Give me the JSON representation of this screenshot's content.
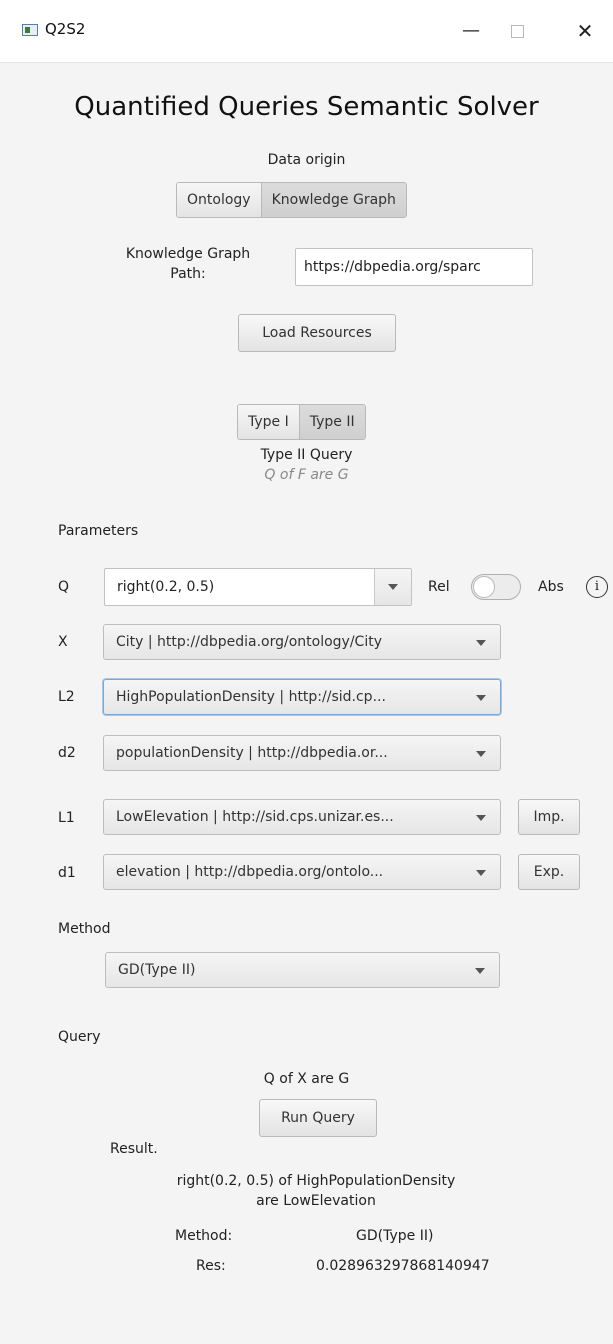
{
  "window": {
    "title": "Q2S2",
    "min_glyph": "—",
    "close_glyph": "✕"
  },
  "app_title": "Quantified Queries Semantic Solver",
  "data_origin": {
    "label": "Data origin",
    "options": [
      "Ontology",
      "Knowledge Graph"
    ],
    "selected": "Knowledge Graph"
  },
  "kg_path": {
    "label_line1": "Knowledge Graph",
    "label_line2": "Path:",
    "value": "https://dbpedia.org/sparc"
  },
  "load_button": "Load Resources",
  "query_type": {
    "options": [
      "Type I",
      "Type II"
    ],
    "selected": "Type II",
    "title": "Type II Query",
    "pattern": "Q of F are G"
  },
  "parameters": {
    "header": "Parameters",
    "q": {
      "label": "Q",
      "value": "right(0.2, 0.5)",
      "rel": "Rel",
      "abs": "Abs",
      "info_glyph": "i"
    },
    "x": {
      "label": "X",
      "value": "City | http://dbpedia.org/ontology/City"
    },
    "l2": {
      "label": "L2",
      "value": "HighPopulationDensity | http://sid.cp..."
    },
    "d2": {
      "label": "d2",
      "value": "populationDensity | http://dbpedia.or..."
    },
    "l1": {
      "label": "L1",
      "value": "LowElevation | http://sid.cps.unizar.es...",
      "button": "Imp."
    },
    "d1": {
      "label": "d1",
      "value": "elevation | http://dbpedia.org/ontolo...",
      "button": "Exp."
    }
  },
  "method": {
    "header": "Method",
    "value": "GD(Type II)"
  },
  "query": {
    "header": "Query",
    "pattern": "Q of X are G",
    "run_button": "Run Query"
  },
  "result": {
    "header": "Result.",
    "line1": "right(0.2, 0.5) of HighPopulationDensity",
    "line2": "are LowElevation",
    "method_label": "Method:",
    "method_value": "GD(Type II)",
    "res_label": "Res:",
    "res_value": "0.028963297868140947"
  }
}
